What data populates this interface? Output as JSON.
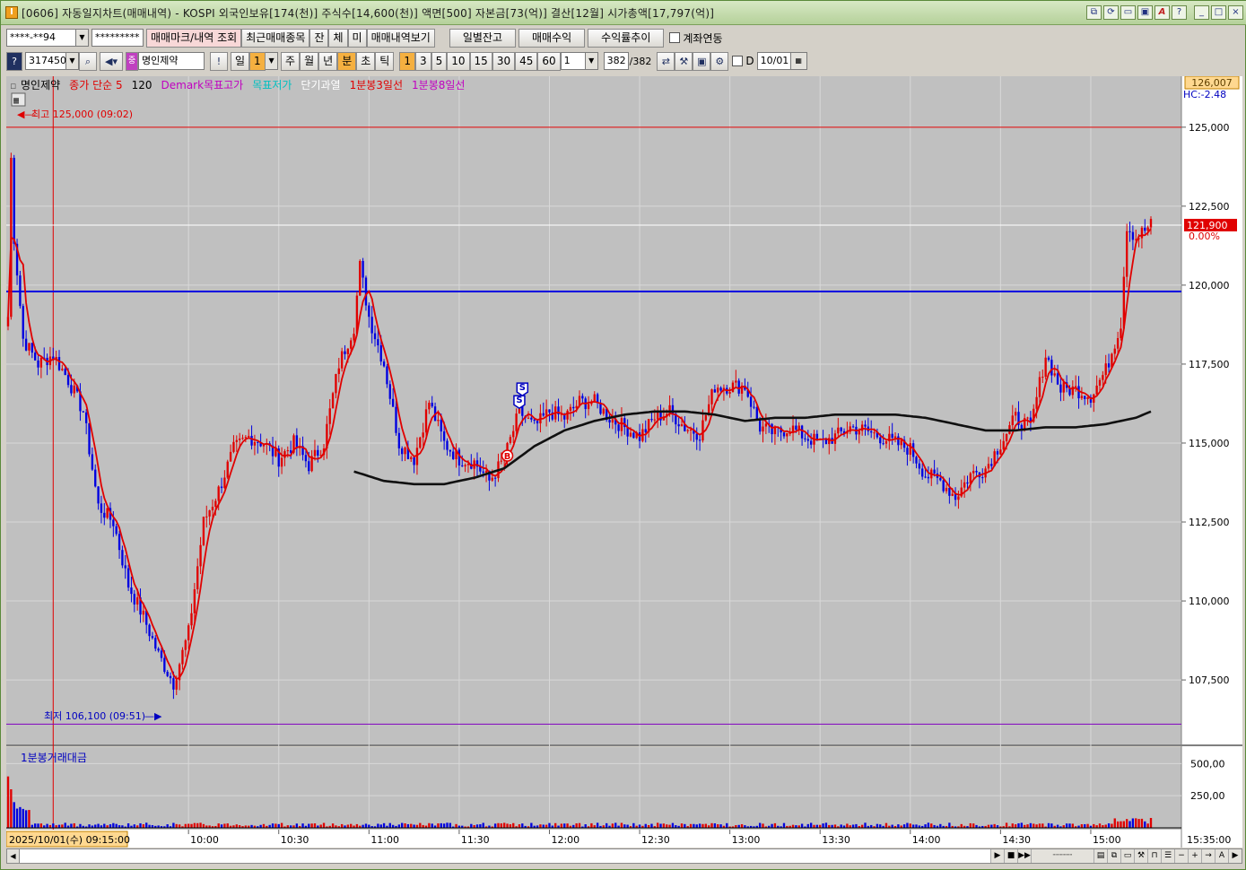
{
  "window": {
    "title": "[0606] 자동일지차트(매매내역) - KOSPI 외국인보유[174(천)] 주식수[14,600(천)] 액면[500] 자본금[73(억)] 결산[12월] 시가총액[17,797(억)]",
    "app_icon_label": "I",
    "buttons": [
      "⧉",
      "⟳",
      "▭",
      "▣",
      "A",
      "?",
      "_",
      "□",
      "×"
    ]
  },
  "toolbar1": {
    "account": "****-**94",
    "password": "*********",
    "tab_trade_mark": "매매마크/내역 조회",
    "tab_recent": "최근매매종목",
    "btn_jan": "잔",
    "btn_che": "체",
    "btn_mi": "미",
    "btn_history": "매매내역보기",
    "btn_daily_balance": "일별잔고",
    "btn_trade_profit": "매매수익",
    "btn_return_trend": "수익률추이",
    "chk_account_link": "계좌연동"
  },
  "toolbar2": {
    "stock_code": "317450",
    "stock_name": "명인제약",
    "period_day": "일",
    "period_value": "1",
    "period_week": "주",
    "period_month": "월",
    "period_year": "년",
    "period_minute": "분",
    "period_second": "초",
    "period_tick": "틱",
    "intervals": [
      "1",
      "3",
      "5",
      "10",
      "15",
      "30",
      "45",
      "60"
    ],
    "count_value": "1",
    "bars_shown": "382",
    "bars_total": "/382",
    "chk_d": "D",
    "date": "10/01"
  },
  "legend": {
    "items": [
      {
        "label": "명인제약",
        "color": "#000000"
      },
      {
        "label": "종가 단순 5",
        "color": "#e00000"
      },
      {
        "label": "120",
        "color": "#000000"
      },
      {
        "label": "Demark목표고가",
        "color": "#c000c0"
      },
      {
        "label": "목표저가",
        "color": "#00c0c0"
      },
      {
        "label": "단기과열",
        "color": "#ffffff"
      },
      {
        "label": "1분봉3일선",
        "color": "#e00000"
      },
      {
        "label": "1분봉8일선",
        "color": "#c000c0"
      }
    ]
  },
  "annotations": {
    "high": "최고 125,000 (09:02)",
    "low": "최저 106,100 (09:51)",
    "top_value": "126,007",
    "hc": "HC:-2.48",
    "current_price": "121,900",
    "current_change": "0.00%",
    "volume_title": "1분봉거래대금",
    "start_time": "2025/10/01(수) 09:15:00",
    "end_time": "15:35:00"
  },
  "chart_data": {
    "type": "candlestick",
    "y_ticks": [
      "125,000",
      "122,500",
      "120,000",
      "117,500",
      "115,000",
      "112,500",
      "110,000",
      "107,500"
    ],
    "ylim": [
      105600,
      126500
    ],
    "volume_ticks": [
      "500,00",
      "250,00"
    ],
    "x_ticks": [
      "10:00",
      "10:30",
      "11:00",
      "11:30",
      "12:00",
      "12:30",
      "13:00",
      "13:30",
      "14:00",
      "14:30",
      "15:00"
    ],
    "reference_lines": [
      {
        "value": 125000,
        "color": "#e00000"
      },
      {
        "value": 119800,
        "color": "#0000e0"
      },
      {
        "value": 106100,
        "color": "#8000c0"
      }
    ],
    "markers": [
      {
        "label": "S",
        "value": 116300,
        "x": "11:50"
      },
      {
        "label": "S",
        "value": 116700,
        "x": "11:51"
      },
      {
        "label": "B",
        "value": 114600,
        "x": "11:46"
      }
    ],
    "price_keypoints": [
      [
        "09:00",
        119000
      ],
      [
        "09:01",
        124000
      ],
      [
        "09:02",
        121500
      ],
      [
        "09:05",
        118300
      ],
      [
        "09:10",
        117500
      ],
      [
        "09:15",
        117800
      ],
      [
        "09:20",
        117000
      ],
      [
        "09:25",
        116000
      ],
      [
        "09:30",
        113000
      ],
      [
        "09:35",
        112500
      ],
      [
        "09:40",
        110500
      ],
      [
        "09:45",
        109500
      ],
      [
        "09:50",
        108300
      ],
      [
        "09:55",
        107400
      ],
      [
        "10:00",
        109000
      ],
      [
        "10:05",
        112500
      ],
      [
        "10:10",
        113500
      ],
      [
        "10:15",
        114800
      ],
      [
        "10:20",
        115200
      ],
      [
        "10:25",
        115000
      ],
      [
        "10:30",
        114500
      ],
      [
        "10:35",
        115000
      ],
      [
        "10:40",
        114300
      ],
      [
        "10:45",
        115000
      ],
      [
        "10:50",
        117500
      ],
      [
        "10:55",
        118700
      ],
      [
        "10:57",
        120600
      ],
      [
        "11:00",
        119000
      ],
      [
        "11:05",
        117500
      ],
      [
        "11:10",
        115000
      ],
      [
        "11:15",
        114500
      ],
      [
        "11:20",
        116300
      ],
      [
        "11:25",
        115000
      ],
      [
        "11:30",
        114500
      ],
      [
        "11:35",
        114400
      ],
      [
        "11:40",
        113800
      ],
      [
        "11:45",
        114500
      ],
      [
        "11:50",
        116000
      ],
      [
        "11:55",
        115500
      ],
      [
        "12:00",
        116000
      ],
      [
        "12:05",
        115800
      ],
      [
        "12:10",
        116300
      ],
      [
        "12:15",
        116300
      ],
      [
        "12:20",
        115800
      ],
      [
        "12:25",
        115500
      ],
      [
        "12:30",
        115200
      ],
      [
        "12:35",
        115800
      ],
      [
        "12:40",
        116000
      ],
      [
        "12:45",
        115500
      ],
      [
        "12:50",
        115300
      ],
      [
        "12:55",
        116800
      ],
      [
        "13:00",
        116800
      ],
      [
        "13:05",
        116800
      ],
      [
        "13:10",
        115500
      ],
      [
        "13:15",
        115300
      ],
      [
        "13:20",
        115500
      ],
      [
        "13:25",
        115200
      ],
      [
        "13:30",
        115000
      ],
      [
        "13:35",
        115200
      ],
      [
        "13:40",
        115500
      ],
      [
        "13:45",
        115400
      ],
      [
        "13:50",
        115200
      ],
      [
        "13:55",
        115000
      ],
      [
        "14:00",
        114800
      ],
      [
        "14:05",
        114000
      ],
      [
        "14:10",
        113800
      ],
      [
        "14:15",
        113300
      ],
      [
        "14:20",
        114000
      ],
      [
        "14:25",
        114200
      ],
      [
        "14:30",
        115000
      ],
      [
        "14:35",
        115800
      ],
      [
        "14:40",
        115500
      ],
      [
        "14:45",
        117800
      ],
      [
        "14:50",
        116700
      ],
      [
        "14:55",
        116700
      ],
      [
        "15:00",
        116500
      ],
      [
        "15:05",
        117300
      ],
      [
        "15:10",
        118800
      ],
      [
        "15:12",
        121900
      ],
      [
        "15:15",
        121500
      ],
      [
        "15:20",
        121900
      ]
    ],
    "ma120_keypoints": [
      [
        "10:55",
        114100
      ],
      [
        "11:05",
        113800
      ],
      [
        "11:15",
        113700
      ],
      [
        "11:25",
        113700
      ],
      [
        "11:35",
        113900
      ],
      [
        "11:45",
        114200
      ],
      [
        "11:55",
        114900
      ],
      [
        "12:05",
        115400
      ],
      [
        "12:15",
        115700
      ],
      [
        "12:25",
        115900
      ],
      [
        "12:35",
        116000
      ],
      [
        "12:45",
        116000
      ],
      [
        "12:55",
        115900
      ],
      [
        "13:05",
        115700
      ],
      [
        "13:15",
        115800
      ],
      [
        "13:25",
        115800
      ],
      [
        "13:35",
        115900
      ],
      [
        "13:45",
        115900
      ],
      [
        "13:55",
        115900
      ],
      [
        "14:05",
        115800
      ],
      [
        "14:15",
        115600
      ],
      [
        "14:25",
        115400
      ],
      [
        "14:35",
        115400
      ],
      [
        "14:45",
        115500
      ],
      [
        "14:55",
        115500
      ],
      [
        "15:05",
        115600
      ],
      [
        "15:15",
        115800
      ],
      [
        "15:20",
        116000
      ]
    ]
  }
}
